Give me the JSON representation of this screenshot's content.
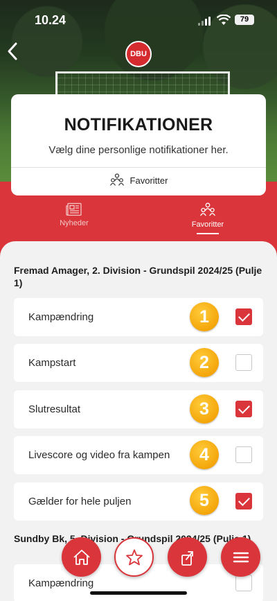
{
  "status_bar": {
    "time": "10.24",
    "battery": "79"
  },
  "header": {
    "logo_text": "DBU"
  },
  "title_card": {
    "title": "NOTIFIKATIONER",
    "subtitle": "Vælg dine personlige notifikationer her.",
    "favorites_label": "Favoritter"
  },
  "tabs": [
    {
      "label": "Nyheder",
      "icon": "newspaper-icon",
      "active": false
    },
    {
      "label": "Favoritter",
      "icon": "people-icon",
      "active": true
    }
  ],
  "groups": [
    {
      "title": "Fremad Amager, 2. Division - Grundspil 2024/25 (Pulje 1)",
      "items": [
        {
          "label": "Kampændring",
          "checked": true,
          "badge": "1"
        },
        {
          "label": "Kampstart",
          "checked": false,
          "badge": "2"
        },
        {
          "label": "Slutresultat",
          "checked": true,
          "badge": "3"
        },
        {
          "label": "Livescore og video fra kampen",
          "checked": false,
          "badge": "4"
        },
        {
          "label": "Gælder for hele puljen",
          "checked": true,
          "badge": "5"
        }
      ]
    },
    {
      "title": "Sundby Bk, 5. Division - Grundspil 2024/25 (Pulje 1)",
      "items": [
        {
          "label": "Kampændring",
          "checked": false
        }
      ]
    }
  ],
  "bottom_actions": [
    "home-icon",
    "star-icon",
    "share-icon",
    "menu-icon"
  ],
  "colors": {
    "accent": "#d9353a",
    "badge": "#f4a60a"
  }
}
